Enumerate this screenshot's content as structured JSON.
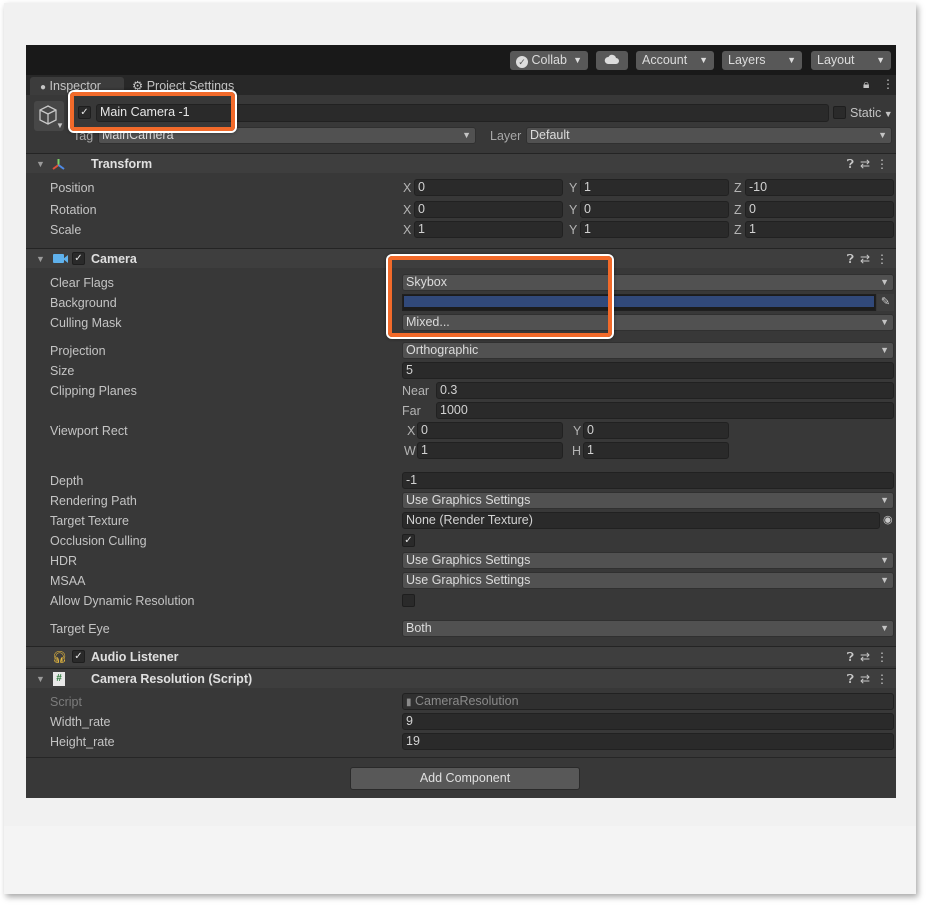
{
  "toolbar": {
    "collab_label": "Collab",
    "account_label": "Account",
    "layers_label": "Layers",
    "layout_label": "Layout"
  },
  "tabs": [
    {
      "label": "Inspector"
    },
    {
      "label": "Project Settings"
    }
  ],
  "object": {
    "name": "Main Camera -1",
    "static_label": "Static",
    "tag_label": "Tag",
    "tag_value": "MainCamera",
    "layer_label": "Layer",
    "layer_value": "Default"
  },
  "transform": {
    "title": "Transform",
    "rows": [
      {
        "label": "Position",
        "x": "0",
        "y": "1",
        "z": "-10"
      },
      {
        "label": "Rotation",
        "x": "0",
        "y": "0",
        "z": "0"
      },
      {
        "label": "Scale",
        "x": "1",
        "y": "1",
        "z": "1"
      }
    ]
  },
  "axis": {
    "x": "X",
    "y": "Y",
    "z": "Z",
    "w": "W",
    "h": "H"
  },
  "camera": {
    "title": "Camera",
    "clear_flags": {
      "label": "Clear Flags",
      "value": "Skybox"
    },
    "background": {
      "label": "Background",
      "color": "#31497a"
    },
    "culling_mask": {
      "label": "Culling Mask",
      "value": "Mixed..."
    },
    "projection": {
      "label": "Projection",
      "value": "Orthographic"
    },
    "size": {
      "label": "Size",
      "value": "5"
    },
    "clipping": {
      "label": "Clipping Planes",
      "near_label": "Near",
      "near": "0.3",
      "far_label": "Far",
      "far": "1000"
    },
    "viewport": {
      "label": "Viewport Rect",
      "x": "0",
      "y": "0",
      "w": "1",
      "h": "1"
    },
    "depth": {
      "label": "Depth",
      "value": "-1"
    },
    "rendering_path": {
      "label": "Rendering Path",
      "value": "Use Graphics Settings"
    },
    "target_texture": {
      "label": "Target Texture",
      "value": "None (Render Texture)"
    },
    "occlusion": {
      "label": "Occlusion Culling",
      "checked": true
    },
    "hdr": {
      "label": "HDR",
      "value": "Use Graphics Settings"
    },
    "msaa": {
      "label": "MSAA",
      "value": "Use Graphics Settings"
    },
    "dynamic_res": {
      "label": "Allow Dynamic Resolution",
      "checked": false
    },
    "target_eye": {
      "label": "Target Eye",
      "value": "Both"
    }
  },
  "audio_listener": {
    "title": "Audio Listener"
  },
  "camera_resolution": {
    "title": "Camera Resolution (Script)",
    "script_label": "Script",
    "script_value": "CameraResolution",
    "width_label": "Width_rate",
    "width_value": "9",
    "height_label": "Height_rate",
    "height_value": "19"
  },
  "add_component_label": "Add Component",
  "colors": {
    "highlight": "#f26a2a",
    "panel_bg": "#383838",
    "toolbar_bg": "#191919"
  }
}
